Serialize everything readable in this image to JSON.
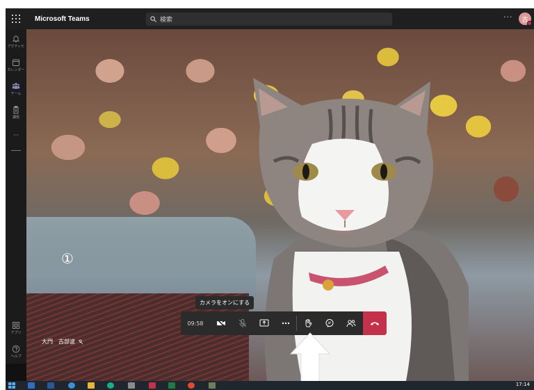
{
  "window": {
    "app_title": "Microsoft Teams"
  },
  "search": {
    "label": "検索"
  },
  "topbar": {
    "more": "···",
    "avatar_initial": "古"
  },
  "rail": {
    "items": [
      {
        "label": "アクティビ",
        "icon": "bell-icon"
      },
      {
        "label": "カレンダー",
        "icon": "calendar-icon"
      },
      {
        "label": "チーム",
        "icon": "teams-icon"
      },
      {
        "label": "課題",
        "icon": "assignment-icon"
      },
      {
        "label": "···",
        "icon": "more-icon"
      }
    ],
    "bottom_items": [
      {
        "label": "アプリ",
        "icon": "apps-icon"
      },
      {
        "label": "ヘルプ",
        "icon": "help-icon"
      }
    ]
  },
  "stage": {
    "annotation_number": "①",
    "participant_name": "大門　古部波"
  },
  "tooltip": {
    "text": "カメラをオンにする"
  },
  "controls": {
    "timer": "09:58",
    "buttons": [
      "camera-off-icon",
      "mic-off-icon",
      "share-icon",
      "more-icon",
      "raise-hand-icon",
      "chat-icon",
      "participants-icon",
      "hangup-icon"
    ]
  },
  "taskbar": {
    "clock": "17:14"
  },
  "colors": {
    "hangup": "#c4314b",
    "titlebar": "#1f1f1f",
    "controls": "#2b2b2b",
    "accent": "#8b8cc7"
  }
}
